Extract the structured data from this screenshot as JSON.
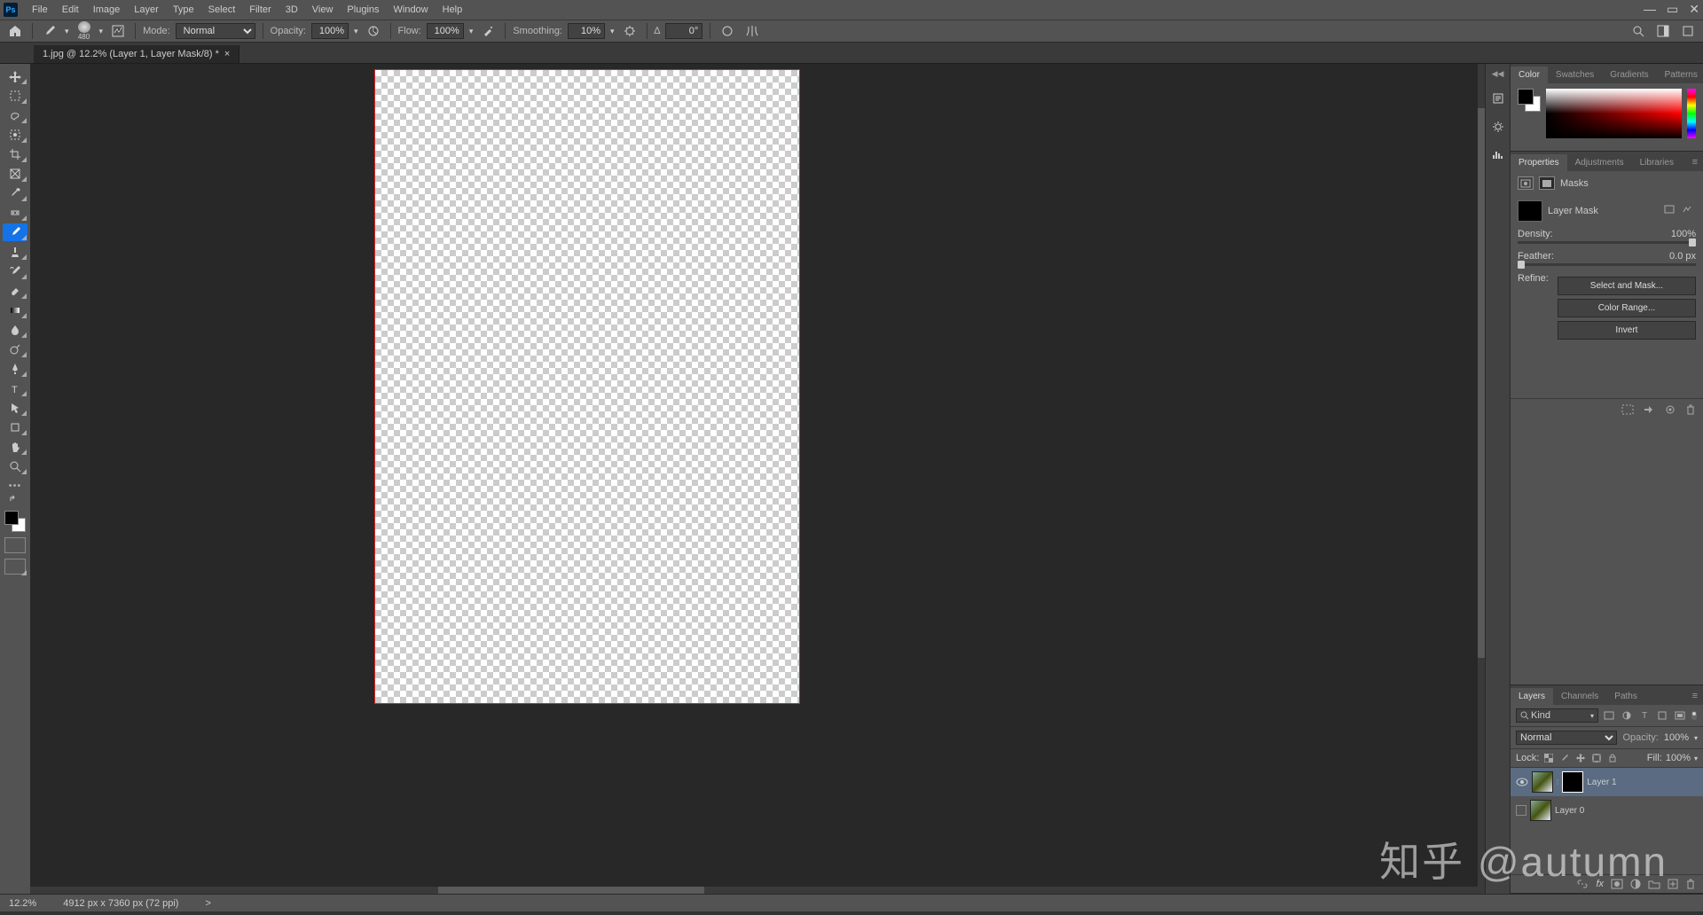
{
  "menubar": [
    "File",
    "Edit",
    "Image",
    "Layer",
    "Type",
    "Select",
    "Filter",
    "3D",
    "View",
    "Plugins",
    "Window",
    "Help"
  ],
  "optbar": {
    "brush_size": "480",
    "mode_label": "Mode:",
    "mode_value": "Normal",
    "opacity_label": "Opacity:",
    "opacity_value": "100%",
    "flow_label": "Flow:",
    "flow_value": "100%",
    "smoothing_label": "Smoothing:",
    "smoothing_value": "10%",
    "angle_icon": "∆",
    "angle_value": "0°"
  },
  "doctab": {
    "title": "1.jpg @ 12.2% (Layer 1, Layer Mask/8) *"
  },
  "panels": {
    "color_tabs": [
      "Color",
      "Swatches",
      "Gradients",
      "Patterns"
    ],
    "props_tabs": [
      "Properties",
      "Adjustments",
      "Libraries"
    ],
    "props": {
      "masks_label": "Masks",
      "mask_name": "Layer Mask",
      "density_label": "Density:",
      "density_value": "100%",
      "feather_label": "Feather:",
      "feather_value": "0.0 px",
      "refine_label": "Refine:",
      "select_mask_btn": "Select and Mask...",
      "color_range_btn": "Color Range...",
      "invert_btn": "Invert"
    },
    "layers_tabs": [
      "Layers",
      "Channels",
      "Paths"
    ],
    "layers": {
      "kind_label": "Kind",
      "blend_mode": "Normal",
      "opacity_label": "Opacity:",
      "opacity_value": "100%",
      "lock_label": "Lock:",
      "fill_label": "Fill:",
      "fill_value": "100%",
      "items": [
        {
          "name": "Layer 1",
          "visible": true,
          "has_mask": true,
          "selected": true
        },
        {
          "name": "Layer 0",
          "visible": false,
          "has_mask": false,
          "selected": false
        }
      ]
    }
  },
  "statusbar": {
    "zoom": "12.2%",
    "docinfo": "4912 px x 7360 px (72 ppi)",
    "chevron": ">"
  },
  "watermark": "知乎 @autumn"
}
